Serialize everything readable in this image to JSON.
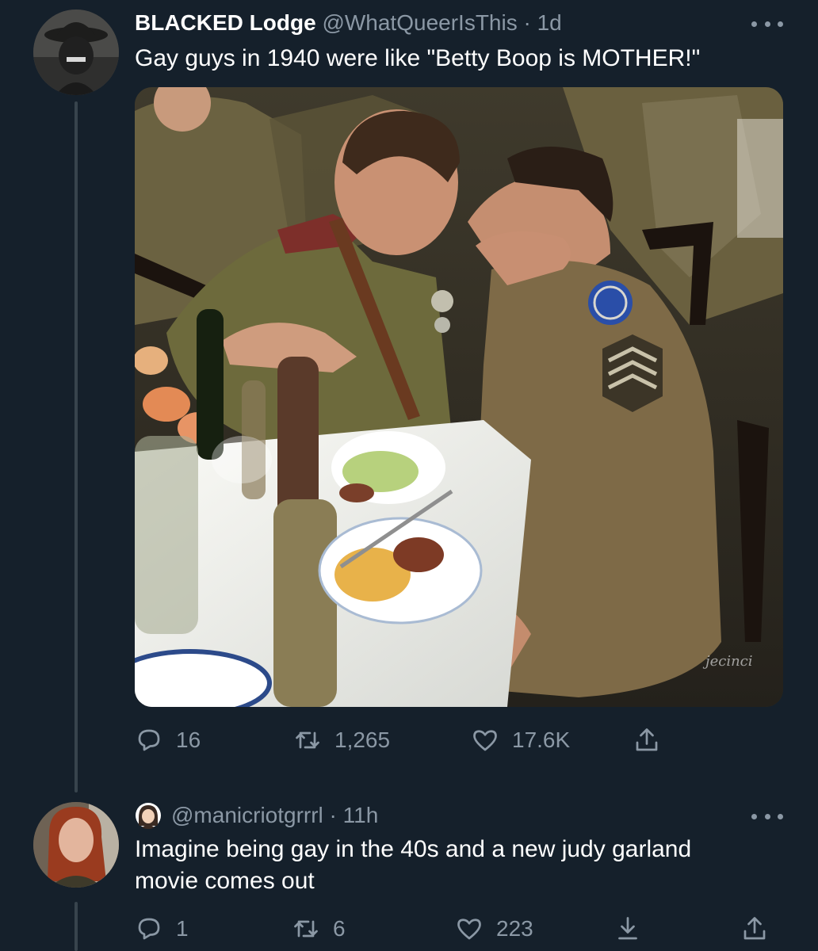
{
  "tweet": {
    "display_name": "BLACKED Lodge",
    "handle": "@WhatQueerIsThis",
    "separator": " · ",
    "time": "1d",
    "text": "Gay guys in 1940 were like \"Betty Boop is MOTHER!\"",
    "photo_watermark": "jecinci",
    "actions": {
      "replies": "16",
      "retweets": "1,265",
      "likes": "17.6K"
    }
  },
  "reply": {
    "handle": "@manicriotgrrrl",
    "separator": " · ",
    "time": "11h",
    "text": "Imagine being gay in the 40s and a new judy garland movie comes out",
    "actions": {
      "replies": "1",
      "retweets": "6",
      "likes": "223"
    }
  },
  "icons": [
    "more-icon",
    "reply-icon",
    "retweet-icon",
    "like-icon",
    "share-icon",
    "download-icon",
    "emoji-icon"
  ],
  "colors": {
    "background": "#15202b",
    "secondary_text": "#8b98a5",
    "thread_line": "#38444d"
  }
}
